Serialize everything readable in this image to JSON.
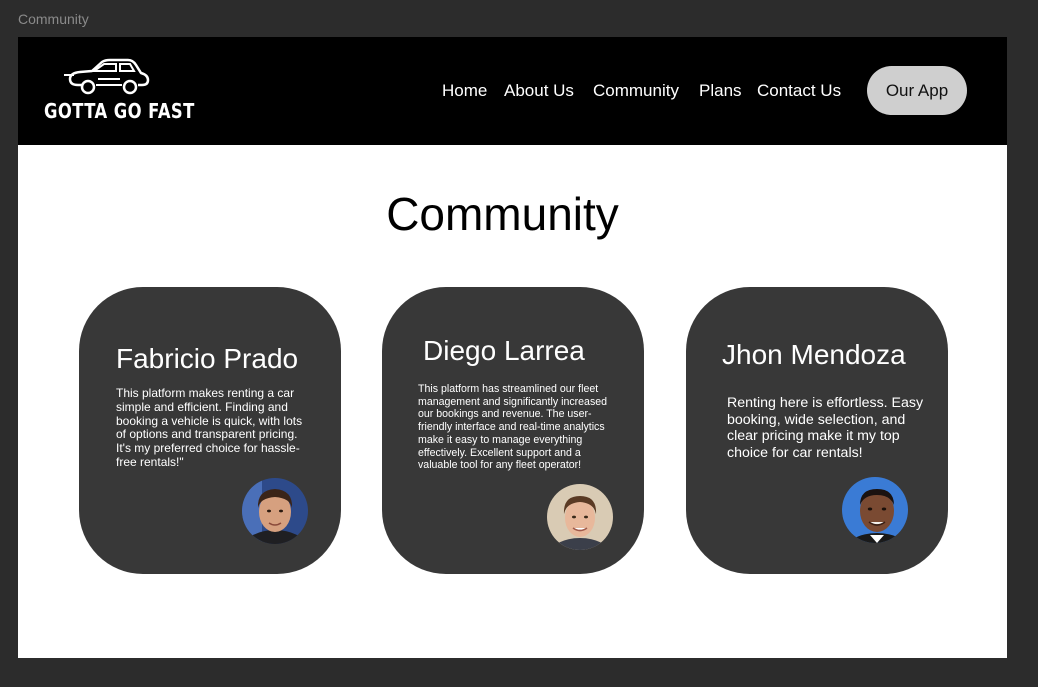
{
  "frame": {
    "label": "Community"
  },
  "header": {
    "logo_text": "GOTTA GO FAST",
    "nav": [
      "Home",
      "About Us",
      "Community",
      "Plans",
      "Contact Us"
    ],
    "app_button": "Our App"
  },
  "main": {
    "title": "Community",
    "cards": [
      {
        "name": "Fabricio Prado",
        "text": "This platform makes renting a car simple and efficient. Finding and booking a vehicle is quick, with lots of options and transparent pricing. It's my preferred choice for hassle-free rentals!\""
      },
      {
        "name": "Diego Larrea",
        "text": "This platform has streamlined our fleet management and significantly increased our bookings and revenue. The user-friendly interface and real-time analytics make it easy to manage everything effectively. Excellent support and a valuable tool for any fleet operator!"
      },
      {
        "name": "Jhon Mendoza",
        "text": "Renting here is effortless. Easy booking, wide selection, and clear pricing make it my top choice for car rentals!"
      }
    ]
  },
  "colors": {
    "navbar": "#000000",
    "card": "#383838",
    "button": "#cfcfcf",
    "canvas": "#2c2c2c"
  }
}
